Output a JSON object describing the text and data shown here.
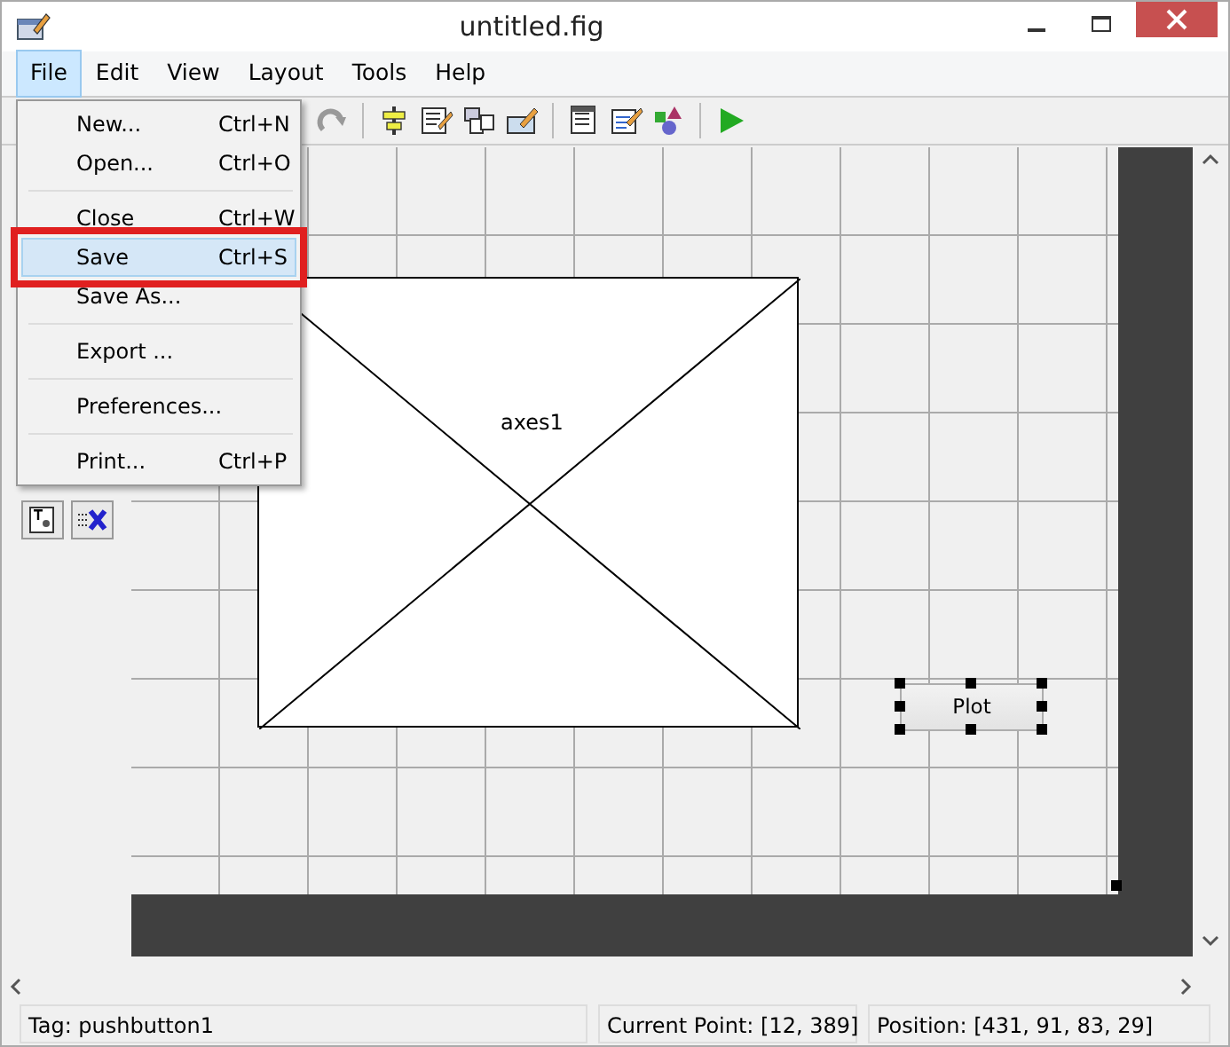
{
  "window": {
    "title": "untitled.fig"
  },
  "menu_bar": [
    {
      "label": "File",
      "selected": true
    },
    {
      "label": "Edit",
      "selected": false
    },
    {
      "label": "View",
      "selected": false
    },
    {
      "label": "Layout",
      "selected": false
    },
    {
      "label": "Tools",
      "selected": false
    },
    {
      "label": "Help",
      "selected": false
    }
  ],
  "file_menu": [
    {
      "label": "New...",
      "shortcut": "Ctrl+N",
      "selected": false,
      "divider_before": false,
      "annotated": false
    },
    {
      "label": "Open...",
      "shortcut": "Ctrl+O",
      "selected": false,
      "divider_before": false,
      "annotated": false
    },
    {
      "label": "Close",
      "shortcut": "Ctrl+W",
      "selected": false,
      "divider_before": true,
      "annotated": false
    },
    {
      "label": "Save",
      "shortcut": "Ctrl+S",
      "selected": true,
      "divider_before": false,
      "annotated": true
    },
    {
      "label": "Save As...",
      "selected": false,
      "divider_before": false,
      "annotated": false
    },
    {
      "label": "Export ...",
      "selected": false,
      "divider_before": true,
      "annotated": false
    },
    {
      "label": "Preferences...",
      "selected": false,
      "divider_before": true,
      "annotated": false
    },
    {
      "label": "Print...",
      "shortcut": "Ctrl+P",
      "selected": false,
      "divider_before": true,
      "annotated": false
    }
  ],
  "canvas": {
    "axes": {
      "label": "axes1"
    },
    "button": {
      "label": "Plot",
      "selected": true
    }
  },
  "status_bar": {
    "tag": "Tag: pushbutton1",
    "current_point": "Current Point:  [12, 389]",
    "position": "Position: [431, 91, 83, 29]"
  }
}
